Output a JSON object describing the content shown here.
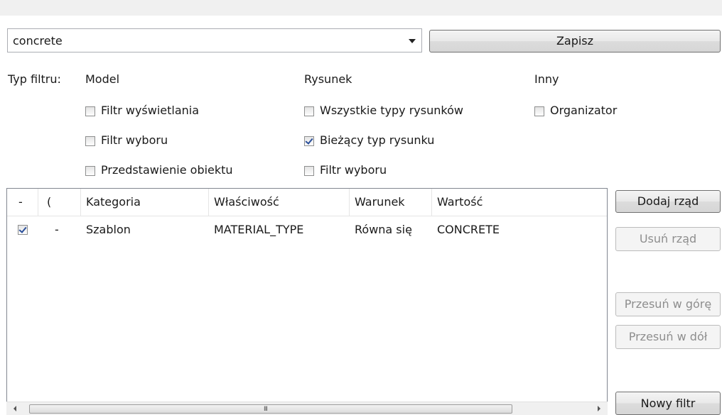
{
  "filter": {
    "value": "concrete",
    "save_label": "Zapisz"
  },
  "filter_type": {
    "label": "Typ filtru:",
    "groups": [
      {
        "heading": "Model",
        "options": [
          {
            "label": "Filtr wyświetlania",
            "checked": false
          },
          {
            "label": "Filtr wyboru",
            "checked": false
          },
          {
            "label": "Przedstawienie obiektu",
            "checked": false
          }
        ]
      },
      {
        "heading": "Rysunek",
        "options": [
          {
            "label": "Wszystkie typy rysunków",
            "checked": false
          },
          {
            "label": "Bieżący typ rysunku",
            "checked": true
          },
          {
            "label": "Filtr wyboru",
            "checked": false
          }
        ]
      },
      {
        "heading": "Inny",
        "options": [
          {
            "label": "Organizator",
            "checked": false
          }
        ]
      }
    ]
  },
  "table": {
    "headers": [
      "-",
      "(",
      "Kategoria",
      "Właściwość",
      "Warunek",
      "Wartość"
    ],
    "rows": [
      {
        "checked": true,
        "paren": "-",
        "kategoria": "Szablon",
        "wlasciwosc": "MATERIAL_TYPE",
        "warunek": "Równa się",
        "wartosc": "CONCRETE"
      }
    ]
  },
  "side_buttons": {
    "add_row": "Dodaj rząd",
    "remove_row": "Usuń rząd",
    "move_up": "Przesuń w górę",
    "move_down": "Przesuń w dół",
    "new_filter": "Nowy filtr"
  },
  "scrollbar": {
    "grip": "III"
  }
}
